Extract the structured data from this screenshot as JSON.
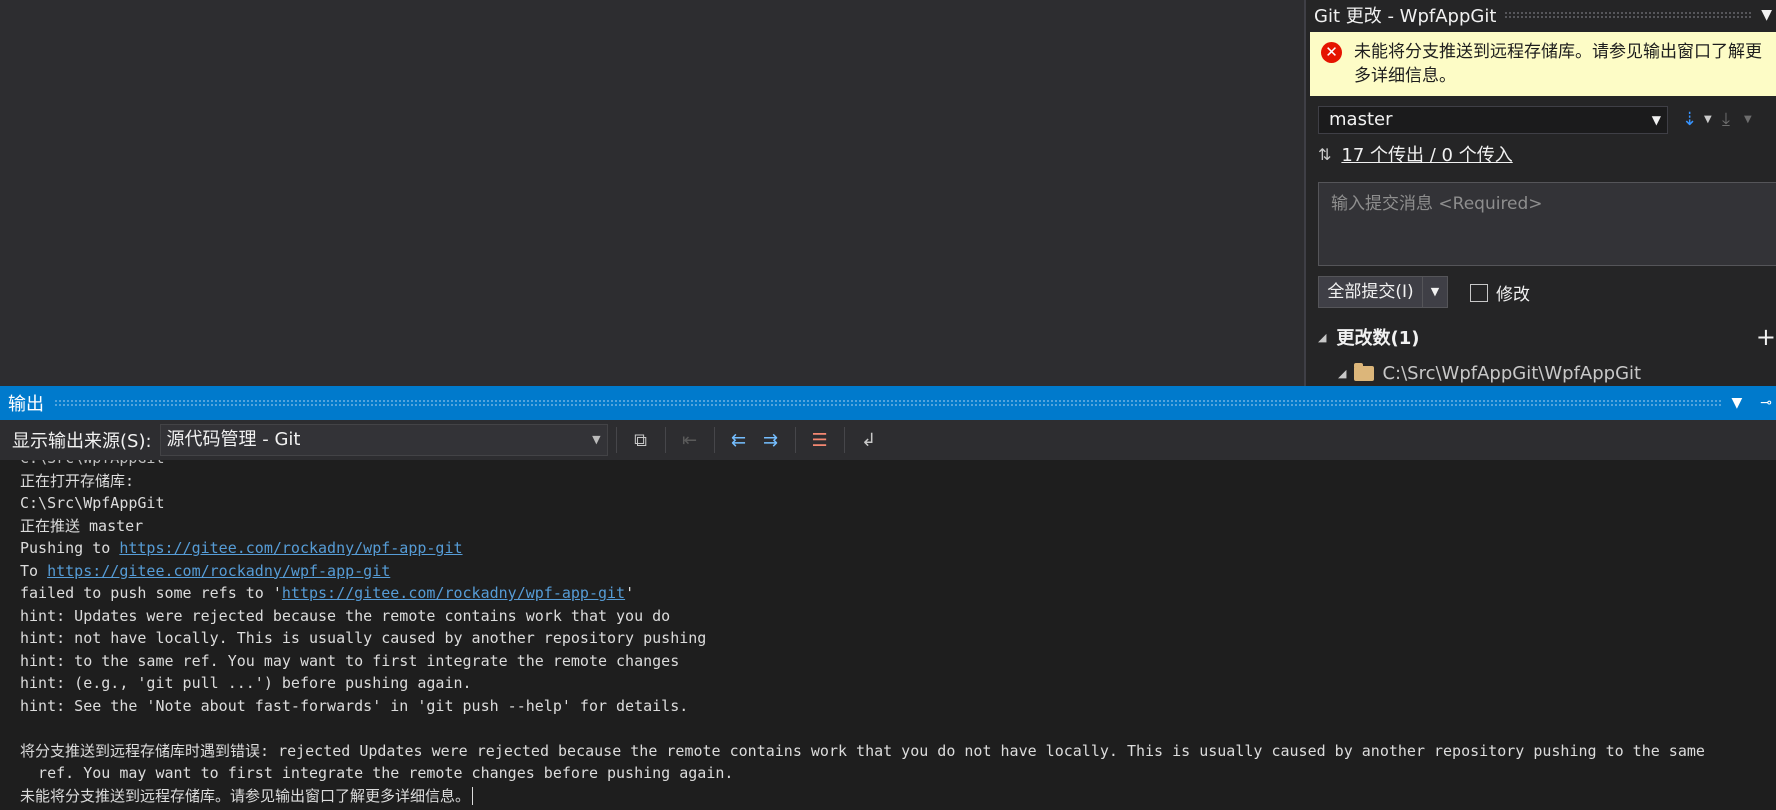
{
  "git_panel": {
    "title": "Git 更改 - WpfAppGit",
    "error_message": "未能将分支推送到远程存储库。请参见输出窗口了解更多详细信息。",
    "branch": "master",
    "sync_icon": "sync-arrows-icon",
    "sync_link": "17 个传出 / 0 个传入",
    "commit_placeholder": "输入提交消息 <Required>",
    "commit_all_label": "全部提交(I)",
    "amend_label": "修改",
    "changes_header": "更改数(1)",
    "folder_path": "C:\\Src\\WpfAppGit\\WpfAppGit"
  },
  "output": {
    "title": "输出",
    "source_label": "显示输出来源(S):",
    "source_value": "源代码管理 - Git",
    "lines": {
      "l0": "C:\\Src\\WpfAppGit",
      "l1": "正在打开存储库:",
      "l2": "C:\\Src\\WpfAppGit",
      "l3": "正在推送 master",
      "l4a": "Pushing to ",
      "l4b": "https://gitee.com/rockadny/wpf-app-git",
      "l5a": "To ",
      "l5b": "https://gitee.com/rockadny/wpf-app-git",
      "l6a": "failed to push some refs to '",
      "l6b": "https://gitee.com/rockadny/wpf-app-git",
      "l6c": "'",
      "l7": "hint: Updates were rejected because the remote contains work that you do",
      "l8": "hint: not have locally. This is usually caused by another repository pushing",
      "l9": "hint: to the same ref. You may want to first integrate the remote changes",
      "l10": "hint: (e.g., 'git pull ...') before pushing again.",
      "l11": "hint: See the 'Note about fast-forwards' in 'git push --help' for details.",
      "l12": "将分支推送到远程存储库时遇到错误: rejected Updates were rejected because the remote contains work that you do not have locally. This is usually caused by another repository pushing to the same",
      "l13": "  ref. You may want to first integrate the remote changes before pushing again.",
      "l14": "未能将分支推送到远程存储库。请参见输出窗口了解更多详细信息。"
    }
  }
}
